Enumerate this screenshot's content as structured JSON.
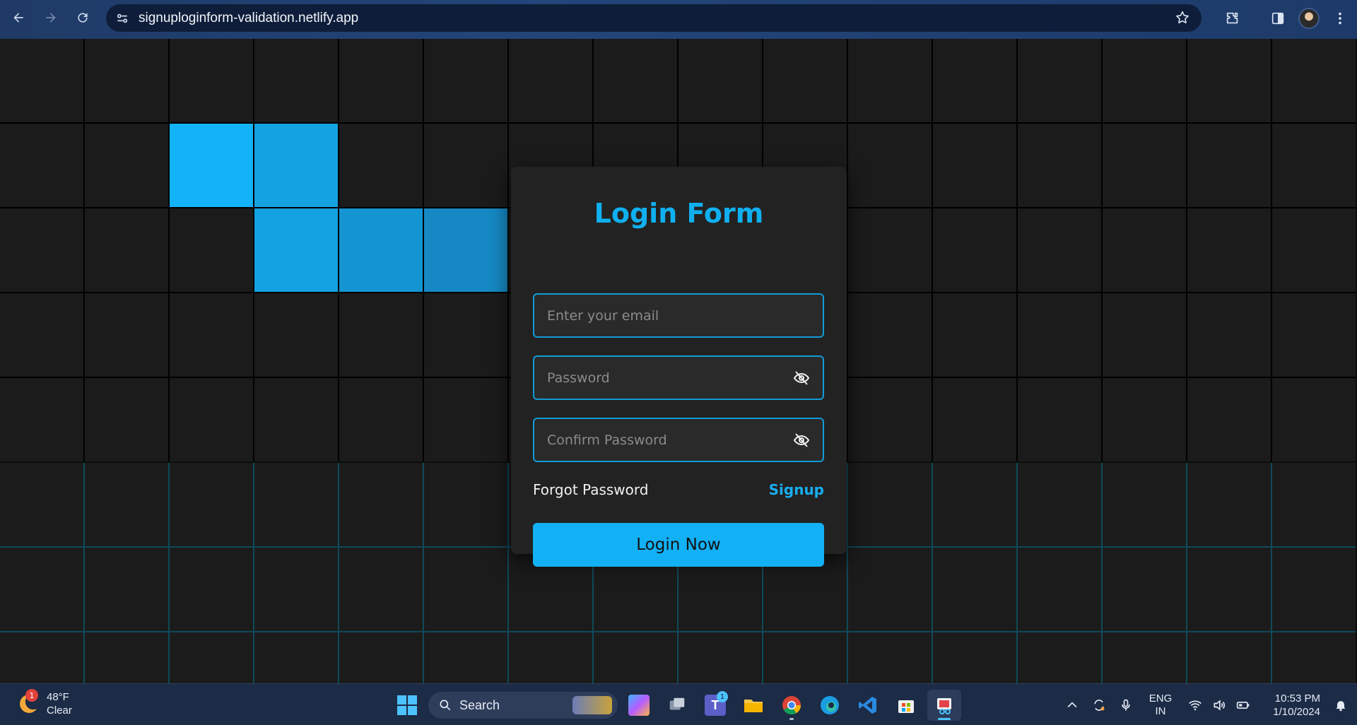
{
  "browser": {
    "url": "signuploginform-validation.netlify.app"
  },
  "login": {
    "title": "Login Form",
    "email_placeholder": "Enter your email",
    "password_placeholder": "Password",
    "confirm_placeholder": "Confirm Password",
    "forgot_label": "Forgot Password",
    "signup_label": "Signup",
    "login_button": "Login Now"
  },
  "colors": {
    "accent": "#12b0f5",
    "card": "#222222",
    "grid_cell": "#1b1b1b"
  },
  "taskbar": {
    "weather_temp": "48°F",
    "weather_desc": "Clear",
    "weather_badge": "1",
    "search_label": "Search",
    "teams_badge": "1",
    "lang_line1": "ENG",
    "lang_line2": "IN",
    "time": "10:53 PM",
    "date": "1/10/2024"
  }
}
